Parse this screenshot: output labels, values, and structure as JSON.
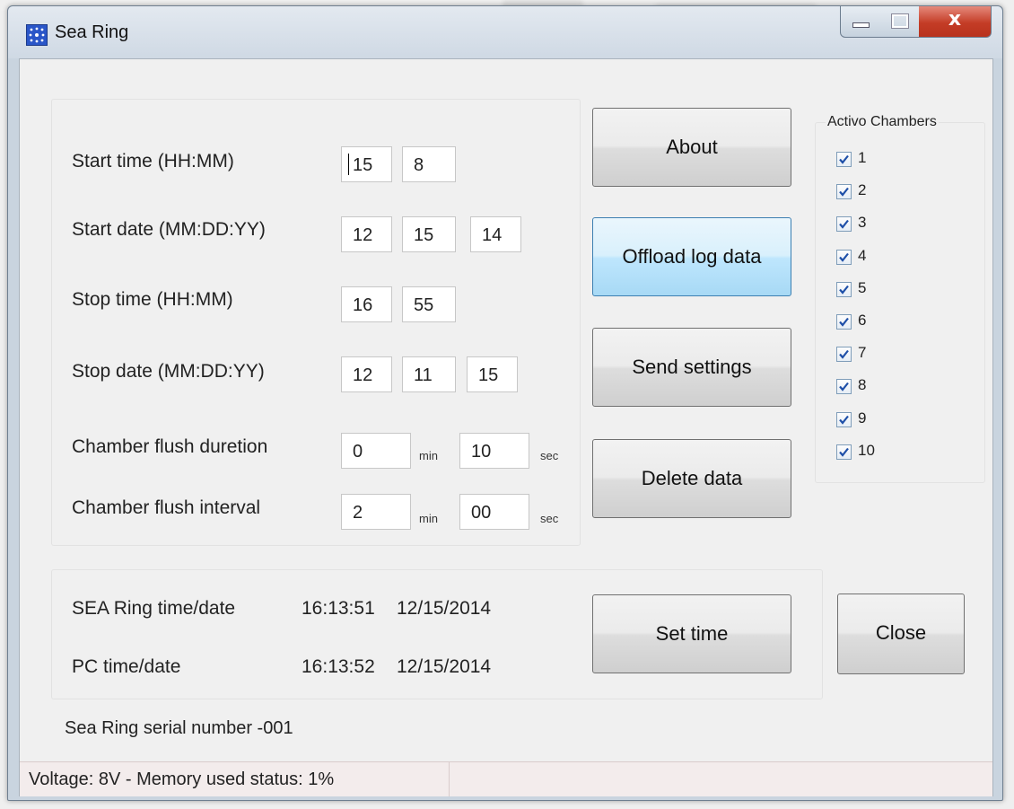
{
  "window": {
    "title": "Sea Ring",
    "close_glyph": "x"
  },
  "settings": {
    "start_time": {
      "label": "Start time (HH:MM)",
      "hours": "15",
      "minutes": "8"
    },
    "start_date": {
      "label": "Start date (MM:DD:YY)",
      "month": "12",
      "day": "15",
      "year": "14"
    },
    "stop_time": {
      "label": "Stop time (HH:MM)",
      "hours": "16",
      "minutes": "55"
    },
    "stop_date": {
      "label": "Stop date (MM:DD:YY)",
      "month": "12",
      "day": "11",
      "year": "15"
    },
    "flush_duration": {
      "label": "Chamber flush duretion",
      "min": "0",
      "min_unit": "min",
      "sec": "10",
      "sec_unit": "sec"
    },
    "flush_interval": {
      "label": "Chamber flush interval",
      "min": "2",
      "min_unit": "min",
      "sec": "00",
      "sec_unit": "sec"
    }
  },
  "buttons": {
    "about": "About",
    "offload": "Offload log data",
    "send": "Send settings",
    "delete": "Delete data",
    "set_time": "Set time",
    "close": "Close"
  },
  "chambers": {
    "title": "Activo Chambers",
    "items": [
      {
        "label": "1",
        "checked": true
      },
      {
        "label": "2",
        "checked": true
      },
      {
        "label": "3",
        "checked": true
      },
      {
        "label": "4",
        "checked": true
      },
      {
        "label": "5",
        "checked": true
      },
      {
        "label": "6",
        "checked": true
      },
      {
        "label": "7",
        "checked": true
      },
      {
        "label": "8",
        "checked": true
      },
      {
        "label": "9",
        "checked": true
      },
      {
        "label": "10",
        "checked": true
      }
    ]
  },
  "clock": {
    "sea_ring": {
      "label": "SEA Ring time/date",
      "time": "16:13:51",
      "date": "12/15/2014"
    },
    "pc": {
      "label": "PC time/date",
      "time": "16:13:52",
      "date": "12/15/2014"
    }
  },
  "serial": "Sea Ring serial number -001",
  "status": "Voltage: 8V - Memory used status: 1%",
  "colors": {
    "accent_button": "#bee6fd",
    "close_button": "#c43c26",
    "app_icon": "#2a56c8"
  },
  "icons": {
    "app": "sea-ring-app-icon",
    "minimize": "minimize-icon",
    "maximize": "maximize-icon",
    "close": "close-icon",
    "check": "checkmark-icon"
  }
}
